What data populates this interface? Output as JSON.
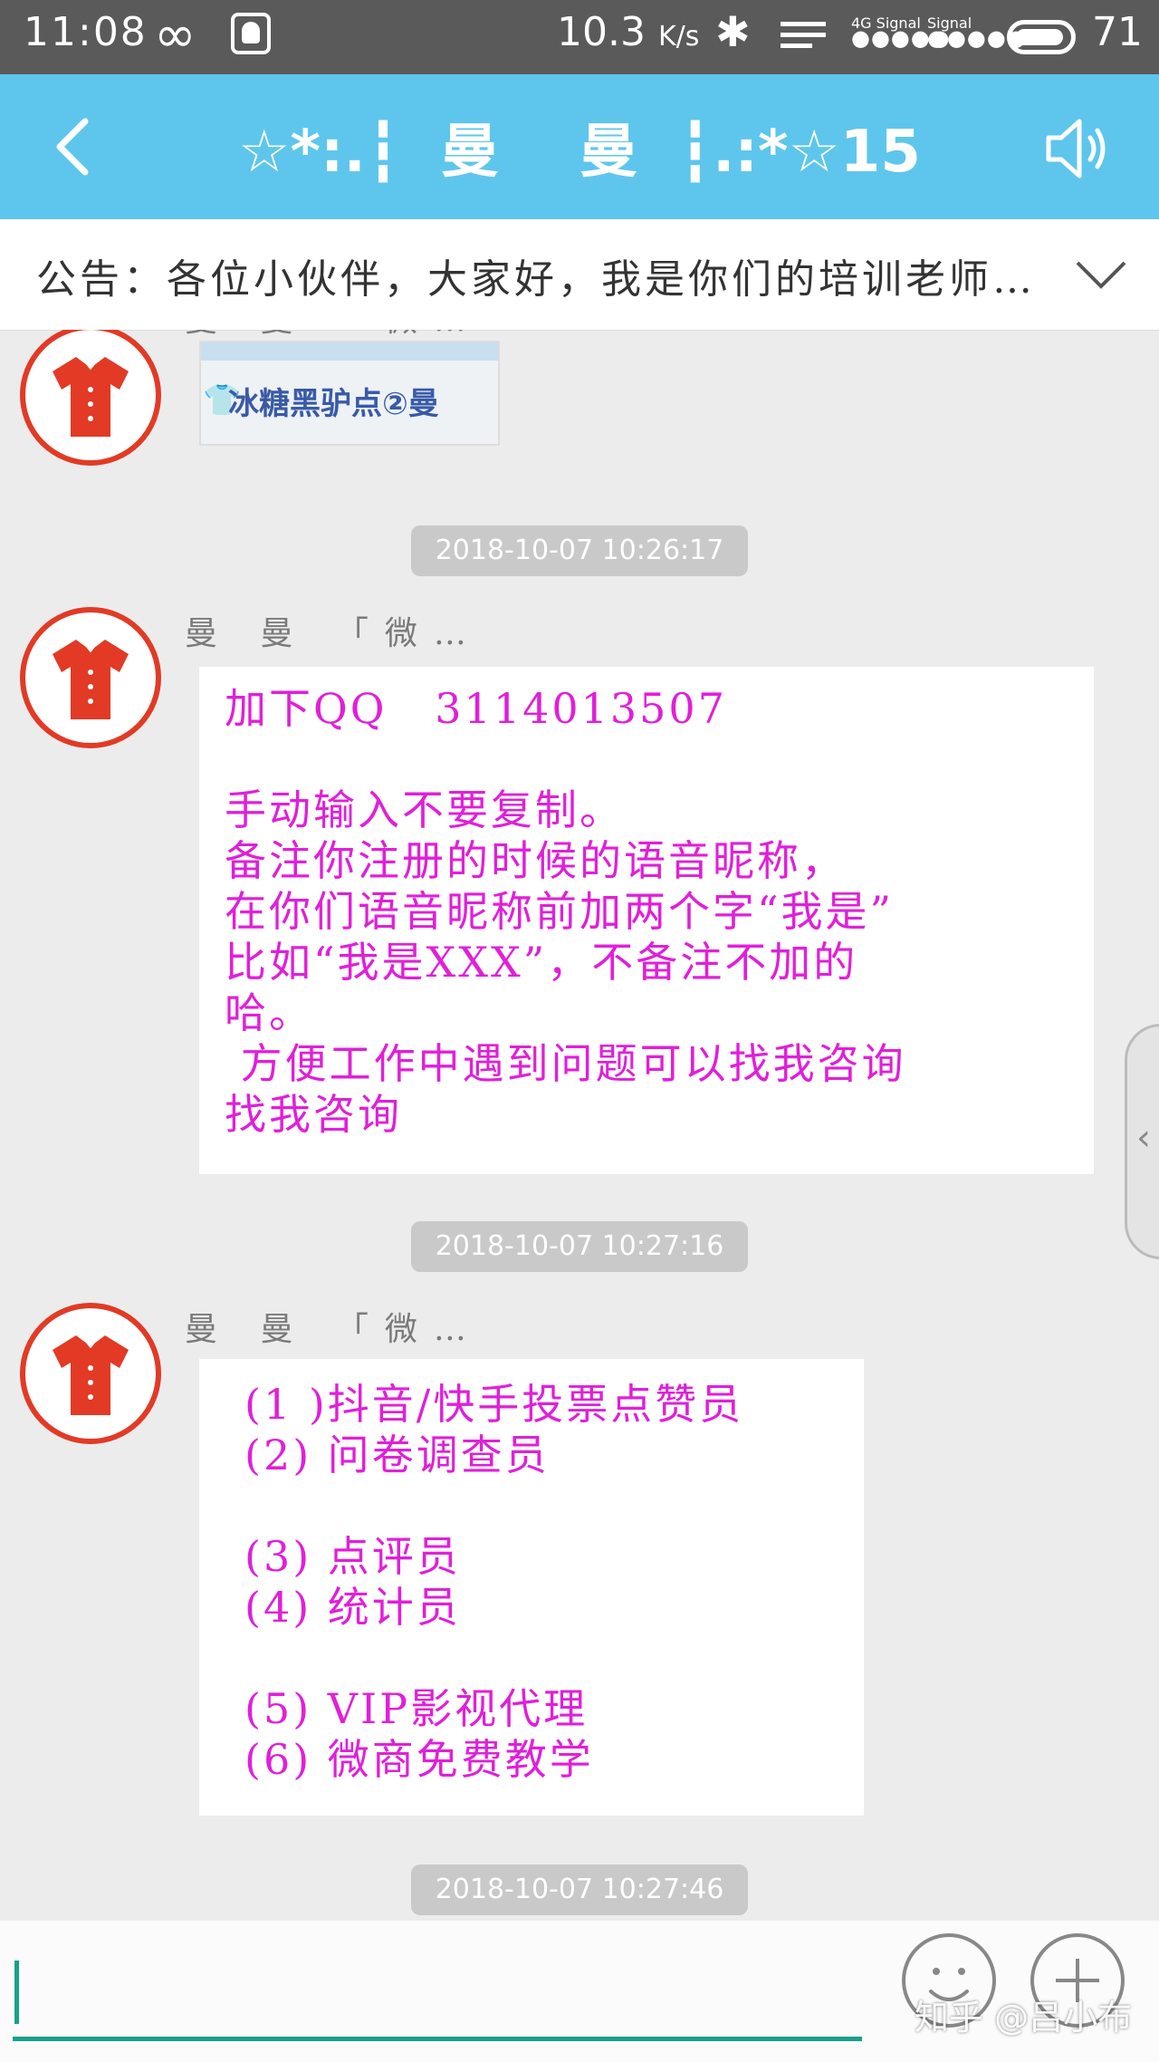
{
  "status_bar": {
    "time": "11:08",
    "speed_value": "10.3",
    "speed_unit": "K/s",
    "signal_1_label": "4G Signal",
    "signal_2_label": "Signal",
    "battery": "71"
  },
  "header": {
    "title": "☆*:.┇  曼    曼  ┇.:*☆15"
  },
  "notice": {
    "text": "公告：各位小伙伴，大家好，我是你们的培训老师…"
  },
  "messages": [
    {
      "sender": "曼 曼 「微…",
      "type": "image",
      "image_caption": "冰糖黑驴点②曼"
    },
    {
      "timestamp": "2018-10-07 10:26:17",
      "sender": "曼 曼 「微…",
      "type": "text",
      "text": "加下QQ   3114013507\n\n手动输入不要复制。\n备注你注册的时候的语音昵称，\n在你们语音昵称前加两个字“我是”\n比如“我是XXX”，不备注不加的\n哈。\n 方便工作中遇到问题可以找我咨询\n找我咨询"
    },
    {
      "timestamp": "2018-10-07 10:27:16",
      "sender": "曼 曼 「微…",
      "type": "text",
      "text": "(1 )抖音/快手投票点赞员\n(2) 问卷调查员\n\n(3) 点评员\n(4) 统计员\n\n(5) VIP影视代理\n(6) 微商免费教学"
    },
    {
      "timestamp": "2018-10-07 10:27:46"
    }
  ],
  "input": {
    "value": ""
  },
  "watermark": "知乎 @吕小布",
  "colors": {
    "header_bg": "#5ec6ec",
    "message_text": "#e020d8",
    "avatar_accent": "#e23a25",
    "input_underline": "#1aa08a"
  }
}
